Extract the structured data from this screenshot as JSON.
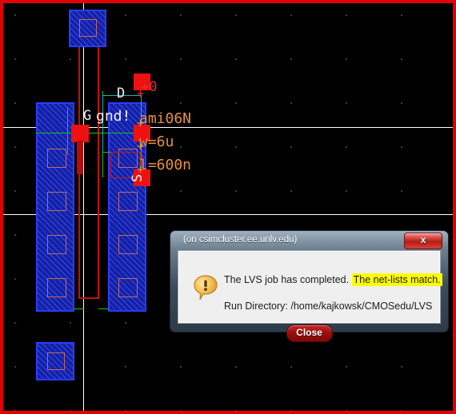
{
  "window": {
    "border_color": "#e00000",
    "canvas_bg": "#000000"
  },
  "layout": {
    "annotations": [
      {
        "id": "d-label",
        "text": "D",
        "color": "white"
      },
      {
        "id": "g-label",
        "text": "G",
        "color": "white"
      },
      {
        "id": "gnd-label",
        "text": "gnd!",
        "color": "white"
      },
      {
        "id": "s-label",
        "text": "S",
        "color": "white"
      },
      {
        "id": "plus-zero",
        "text": "+0",
        "color": "red"
      },
      {
        "id": "model",
        "text": "ami06N",
        "color": "orange"
      },
      {
        "id": "width",
        "text": "w=6u",
        "color": "orange"
      },
      {
        "id": "length",
        "text": "l=600n",
        "color": "orange"
      }
    ],
    "colors": {
      "metal": "#1320a8",
      "metal_border": "#2b3cff",
      "contact": "#ee1111",
      "active": "#c06a66",
      "net_highlight": "#18c418",
      "poly": "#c01010"
    }
  },
  "dialog": {
    "title": "(on csimcluster.ee.unlv.edu)",
    "close_icon": "x",
    "icon_name": "exclamation-balloon-icon",
    "message_prefix": "The LVS job has completed.",
    "message_highlight": "The net-lists match.",
    "highlight_color": "#ffff00",
    "run_directory": "Run Directory: /home/kajkowsk/CMOSedu/LVS",
    "ok_label": "Close"
  }
}
